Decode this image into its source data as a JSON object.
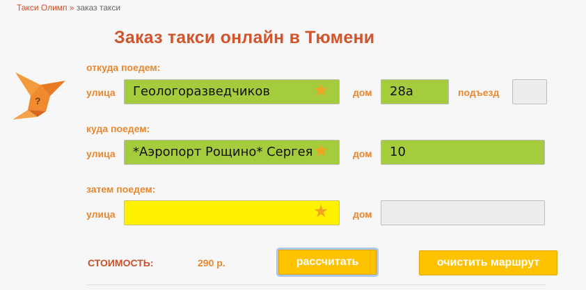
{
  "breadcrumb": {
    "home": "Такси Олимп",
    "separator": "»",
    "current": "заказ такси"
  },
  "page": {
    "title": "Заказ такси онлайн в Тюмени"
  },
  "from": {
    "section_label": "откуда поедем:",
    "street_label": "улица",
    "street_value": "Геологоразведчиков",
    "house_label": "дом",
    "house_value": "28а",
    "entrance_label": "подъезд",
    "entrance_value": ""
  },
  "to": {
    "section_label": "куда поедем:",
    "street_label": "улица",
    "street_value": "*Аэропорт Рощино* Сергея",
    "house_label": "дом",
    "house_value": "10"
  },
  "then": {
    "section_label": "затем поедем:",
    "street_label": "улица",
    "street_value": "",
    "house_label": "дом",
    "house_value": ""
  },
  "cost": {
    "label": "СТОИМОСТЬ:",
    "value": "290 р."
  },
  "buttons": {
    "calculate": "рассчитать",
    "clear": "очистить маршрут"
  },
  "icons": {
    "favorite": "star-icon",
    "logo": "origami-bird-icon"
  },
  "colors": {
    "accent": "#d2542b",
    "label": "#e8872e",
    "filled_field": "#a5cc3c",
    "active_field": "#fff200",
    "button": "#fec200",
    "star": "#f0a422"
  }
}
